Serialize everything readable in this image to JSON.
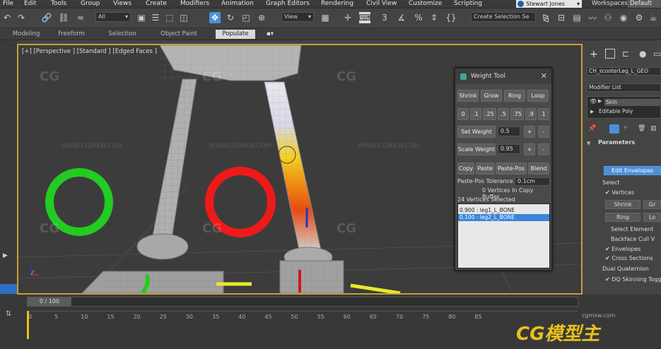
{
  "menu": [
    "File",
    "Edit",
    "Tools",
    "Group",
    "Views",
    "Create",
    "Modifiers",
    "Animation",
    "Graph Editors",
    "Rendering",
    "Civil View",
    "Customize",
    "Scripting"
  ],
  "user": {
    "name": "Stewart Jones",
    "workspaces_label": "Workspaces:",
    "workspace": "Default"
  },
  "toolbar": {
    "filter": "All",
    "view": "View",
    "create_selection": "Create Selection Se"
  },
  "ribbon": {
    "tabs": [
      "Modeling",
      "Freeform",
      "Selection",
      "Object Paint",
      "Populate"
    ],
    "active": "Populate"
  },
  "viewport": {
    "label": "[+] [Perspective ] [Standard ] [Edged Faces ]"
  },
  "weight_tool": {
    "title": "Weight Tool",
    "row1": [
      "Shrink",
      "Grow",
      "Ring",
      "Loop"
    ],
    "presets": [
      "0",
      ".1",
      ".25",
      ".5",
      ".75",
      ".9",
      "1"
    ],
    "set_weight": "Set Weight",
    "set_weight_value": "0.5",
    "scale_weight": "Scale Weight",
    "scale_weight_value": "0.95",
    "row_copy": [
      "Copy",
      "Paste",
      "Paste-Pos",
      "Blend"
    ],
    "paste_pos_tolerance_label": "Paste-Pos Tolerance",
    "paste_pos_tolerance": "0.1cm",
    "copy_buffer": "0 Vertices In Copy Buffer",
    "selected": "24 Vertices Selected",
    "list": [
      "0.900 : leg1_L_BONE",
      "0.100 : leg2_L_BONE"
    ]
  },
  "command_panel": {
    "object_name": "CH_scooterLeg_L_GEO",
    "modifier_list": "Modifier List",
    "stack": [
      "Skin",
      "Editable Poly"
    ],
    "parameters": "Parameters",
    "edit_envelopes": "Edit Envelopes",
    "select": "Select",
    "vertices": "Vertices",
    "shrink": "Shrink",
    "grow": "Gr",
    "ring": "Ring",
    "loop": "Lo",
    "select_element": "Select Element",
    "backface": "Backface Cull V",
    "envelopes": "Envelopes",
    "cross_sections": "Cross Sections",
    "dual_quat": "Dual Quaternion",
    "dq_toggle": "DQ Skinning Toggle"
  },
  "timeline": {
    "frame": "0 / 100",
    "ticks": [
      "0",
      "5",
      "10",
      "15",
      "20",
      "25",
      "30",
      "35",
      "40",
      "45",
      "50",
      "55",
      "60",
      "65",
      "70",
      "75",
      "80",
      "85"
    ]
  },
  "watermarks": [
    "CG模型主",
    "WWW.CGMXW.COM",
    "www.cgmxw.com",
    "cgmxw.com"
  ],
  "colors": {
    "accent": "#c8a032",
    "selection": "#3a86d8",
    "active_button": "#4a90d9"
  }
}
